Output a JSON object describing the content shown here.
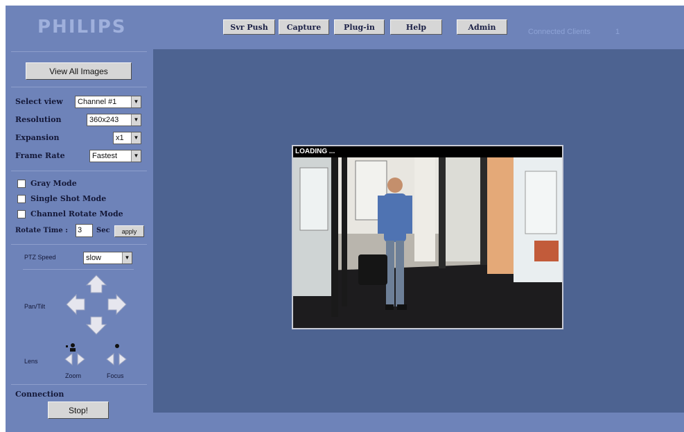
{
  "brand": "PHILIPS",
  "nav": {
    "svr_push": "Svr Push",
    "capture": "Capture",
    "plugin": "Plug-in",
    "help": "Help",
    "admin": "Admin"
  },
  "status": {
    "connected_label": "Connected Clients",
    "connected_count": "1"
  },
  "sidebar": {
    "view_all": "View All Images",
    "select_view": {
      "label": "Select view",
      "value": "Channel #1"
    },
    "resolution": {
      "label": "Resolution",
      "value": "360x243"
    },
    "expansion": {
      "label": "Expansion",
      "value": "x1"
    },
    "frame_rate": {
      "label": "Frame Rate",
      "value": "Fastest"
    },
    "gray_mode": "Gray Mode",
    "single_shot": "Single Shot Mode",
    "channel_rotate": "Channel Rotate Mode",
    "rotate_time": {
      "label": "Rotate Time :",
      "value": "3",
      "unit": "Sec",
      "apply": "apply"
    },
    "ptz_speed": {
      "label": "PTZ Speed",
      "value": "slow"
    },
    "pan_tilt": "Pan/Tilt",
    "lens": "Lens",
    "zoom": "Zoom",
    "focus": "Focus",
    "connection": "Connection",
    "stop": "Stop!"
  },
  "video": {
    "status": "LOADING ..."
  },
  "icons": {
    "select_arrow": "dropdown-arrow-icon",
    "up": "arrow-up-icon",
    "down": "arrow-down-icon",
    "left": "arrow-left-icon",
    "right": "arrow-right-icon",
    "zoom": "zoom-icon",
    "focus": "focus-icon"
  },
  "colors": {
    "page_bg": "#6e83b9",
    "content_bg": "#4d6391",
    "button": "#d6d6d6",
    "text_dark": "#141838"
  }
}
